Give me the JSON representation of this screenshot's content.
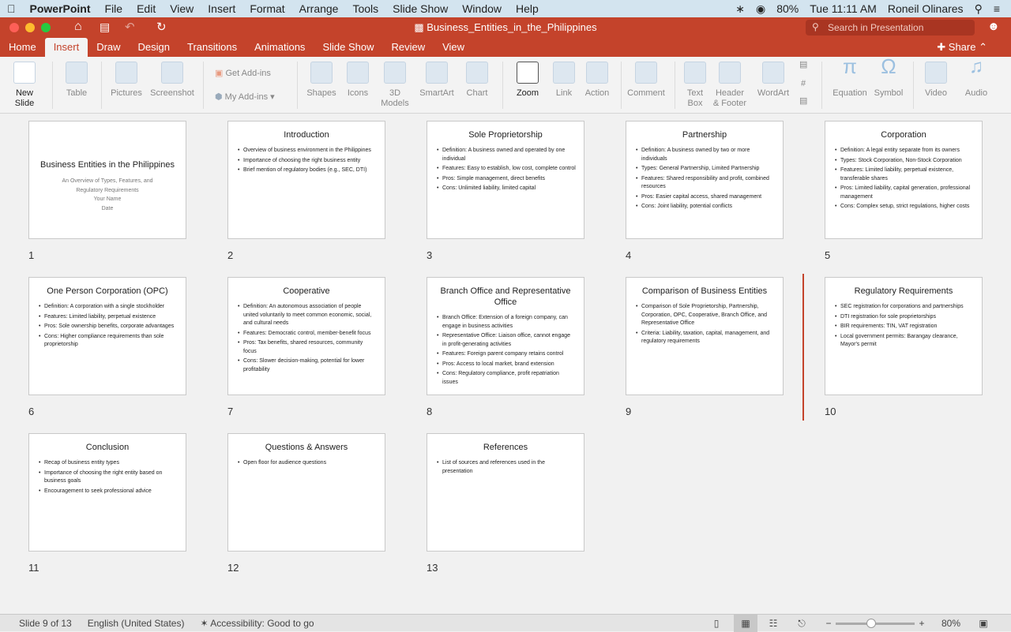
{
  "menubar": {
    "app": "PowerPoint",
    "items": [
      "File",
      "Edit",
      "View",
      "Insert",
      "Format",
      "Arrange",
      "Tools",
      "Slide Show",
      "Window",
      "Help"
    ],
    "battery": "80%",
    "clock": "Tue 11:11 AM",
    "user": "Roneil Olinares"
  },
  "window": {
    "title": "Business_Entities_in_the_Philippines",
    "search_placeholder": "Search in Presentation"
  },
  "tabs": [
    "Home",
    "Insert",
    "Draw",
    "Design",
    "Transitions",
    "Animations",
    "Slide Show",
    "Review",
    "View"
  ],
  "active_tab": "Insert",
  "share_label": "Share",
  "ribbon": {
    "new_slide": "New Slide",
    "table": "Table",
    "pictures": "Pictures",
    "screenshot": "Screenshot",
    "get_addins": "Get Add-ins",
    "my_addins": "My Add-ins",
    "shapes": "Shapes",
    "icons": "Icons",
    "models": "3D Models",
    "smartart": "SmartArt",
    "chart": "Chart",
    "zoom": "Zoom",
    "link": "Link",
    "action": "Action",
    "comment": "Comment",
    "textbox": "Text Box",
    "header_footer": "Header & Footer",
    "wordart": "WordArt",
    "equation": "Equation",
    "symbol": "Symbol",
    "video": "Video",
    "audio": "Audio"
  },
  "slides": [
    {
      "num": "1",
      "title": "Business Entities in the Philippines",
      "subtitle": [
        "An Overview of Types, Features, and Regulatory Requirements",
        "Your Name",
        "Date"
      ]
    },
    {
      "num": "2",
      "title": "Introduction",
      "bullets": [
        "Overview of business environment in the Philippines",
        "Importance of choosing the right business entity",
        "Brief mention of regulatory bodies (e.g., SEC, DTI)"
      ]
    },
    {
      "num": "3",
      "title": "Sole Proprietorship",
      "bullets": [
        "Definition: A business owned and operated by one individual",
        "Features: Easy to establish, low cost, complete control",
        "Pros: Simple management, direct benefits",
        "Cons: Unlimited liability, limited capital"
      ]
    },
    {
      "num": "4",
      "title": "Partnership",
      "bullets": [
        "Definition: A business owned by two or more individuals",
        "Types: General Partnership, Limited Partnership",
        "Features: Shared responsibility and profit, combined resources",
        "Pros: Easier capital access, shared management",
        "Cons: Joint liability, potential conflicts"
      ]
    },
    {
      "num": "5",
      "title": "Corporation",
      "bullets": [
        "Definition: A legal entity separate from its owners",
        "Types: Stock Corporation, Non-Stock Corporation",
        "Features: Limited liability, perpetual existence, transferable shares",
        "Pros: Limited liability, capital generation, professional management",
        "Cons: Complex setup, strict regulations, higher costs"
      ]
    },
    {
      "num": "6",
      "title": "One Person Corporation (OPC)",
      "bullets": [
        "Definition: A corporation with a single stockholder",
        "Features: Limited liability, perpetual existence",
        "Pros: Sole ownership benefits, corporate advantages",
        "Cons: Higher compliance requirements than sole proprietorship"
      ]
    },
    {
      "num": "7",
      "title": "Cooperative",
      "bullets": [
        "Definition: An autonomous association of people united voluntarily to meet common economic, social, and cultural needs",
        "Features: Democratic control, member-benefit focus",
        "Pros: Tax benefits, shared resources, community focus",
        "Cons: Slower decision-making, potential for lower profitability"
      ]
    },
    {
      "num": "8",
      "title": "Branch Office and Representative Office",
      "bullets": [
        "Branch Office: Extension of a foreign company, can engage in business activities",
        "Representative Office: Liaison office, cannot engage in profit-generating activities",
        "Features: Foreign parent company retains control",
        "Pros: Access to local market, brand extension",
        "Cons: Regulatory compliance, profit repatriation issues"
      ]
    },
    {
      "num": "9",
      "title": "Comparison of Business Entities",
      "bullets": [
        "Comparison of Sole Proprietorship, Partnership, Corporation, OPC, Cooperative, Branch Office, and Representative Office",
        "Criteria: Liability, taxation, capital, management, and regulatory requirements"
      ]
    },
    {
      "num": "10",
      "title": "Regulatory Requirements",
      "bullets": [
        "SEC registration for corporations and partnerships",
        "DTI registration for sole proprietorships",
        "BIR requirements: TIN, VAT registration",
        "Local government permits: Barangay clearance, Mayor's permit"
      ]
    },
    {
      "num": "11",
      "title": "Conclusion",
      "bullets": [
        "Recap of business entity types",
        "Importance of choosing the right entity based on business goals",
        "Encouragement to seek professional advice"
      ]
    },
    {
      "num": "12",
      "title": "Questions & Answers",
      "bullets": [
        "Open floor for audience questions"
      ]
    },
    {
      "num": "13",
      "title": "References",
      "bullets": [
        "List of sources and references used in the presentation"
      ]
    }
  ],
  "status": {
    "slide": "Slide 9 of 13",
    "language": "English (United States)",
    "accessibility": "Accessibility: Good to go",
    "zoom": "80%",
    "zoom_fraction": 0.45
  },
  "colors": {
    "accent": "#c4432b"
  }
}
